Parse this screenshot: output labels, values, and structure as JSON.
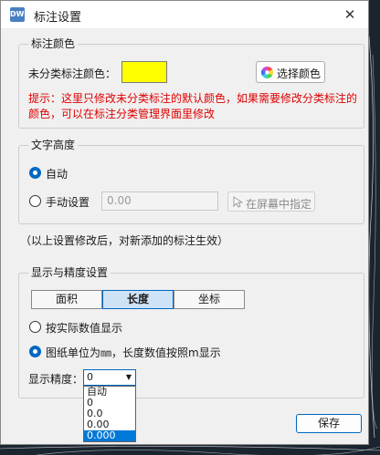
{
  "window": {
    "app_icon": "DWG",
    "title": "标注设置",
    "close_glyph": "✕"
  },
  "color_group": {
    "legend": "标注颜色",
    "label": "未分类标注颜色：",
    "swatch_color": "#ffff00",
    "button_label": "选择颜色",
    "hint": "提示：这里只修改未分类标注的默认颜色，如果需要修改分类标注的颜色，可以在标注分类管理界面里修改"
  },
  "height_group": {
    "legend": "文字高度",
    "options": [
      {
        "label": "自动",
        "selected": true
      },
      {
        "label": "手动设置",
        "selected": false
      }
    ],
    "manual_value": "0.00",
    "pick_button_label": "在屏幕中指定"
  },
  "note": "（以上设置修改后，对新添加的标注生效）",
  "display_group": {
    "legend": "显示与精度设置",
    "tabs": [
      {
        "label": "面积",
        "active": false
      },
      {
        "label": "长度",
        "active": true
      },
      {
        "label": "坐标",
        "active": false
      }
    ],
    "options": [
      {
        "label": "按实际数值显示",
        "selected": false
      },
      {
        "label": "图纸单位为㎜，长度数值按照m显示",
        "selected": true
      }
    ],
    "precision_label": "显示精度：",
    "precision_value": "0",
    "precision_options": [
      "自动",
      "0",
      "0.0",
      "0.00",
      "0.000"
    ],
    "precision_highlighted": "0.000"
  },
  "footer": {
    "save_label": "保存"
  }
}
